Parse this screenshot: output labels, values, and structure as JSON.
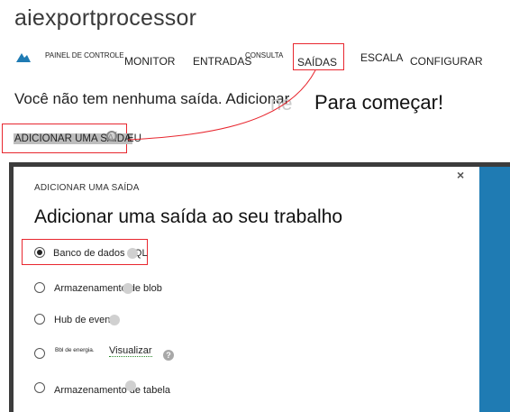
{
  "app": {
    "title": "aiexportprocessor"
  },
  "nav": {
    "dashboard": "PAINEL DE CONTROLE",
    "monitor": "MONITOR",
    "inputs": "ENTRADAS",
    "query": "CONSULTA",
    "outputs": "SAÍDAS",
    "scale": "ESCALA",
    "configure": "CONFIGURAR"
  },
  "main": {
    "no_output_text": "Você não tem nenhuma saída. Adicionar",
    "ghost_text": "ne",
    "get_started": "Para começar!",
    "add_output_link": "ADICIONAR UMA SAÍDA",
    "you_text": "EU"
  },
  "dialog": {
    "subtitle": "ADICIONAR UMA SAÍDA",
    "title": "Adicionar uma saída ao seu trabalho",
    "close_glyph": "×",
    "options": [
      {
        "label": "Banco de dados SQL",
        "selected": true
      },
      {
        "label": "Armazenamento de blob",
        "selected": false
      },
      {
        "label": "Hub de evento",
        "selected": false
      },
      {
        "label": "Bbl de energia.",
        "selected": false,
        "preview": "Visualizar"
      },
      {
        "label": "Armazenamento de tabela",
        "selected": false
      }
    ],
    "help_glyph": "?"
  },
  "colors": {
    "highlight_border": "#e8272f",
    "side_panel": "#1f7bb3",
    "frame": "#3c3c3c"
  },
  "icons": {
    "nav_logo": "cloud-icon",
    "close": "close-icon",
    "help": "help-icon"
  }
}
